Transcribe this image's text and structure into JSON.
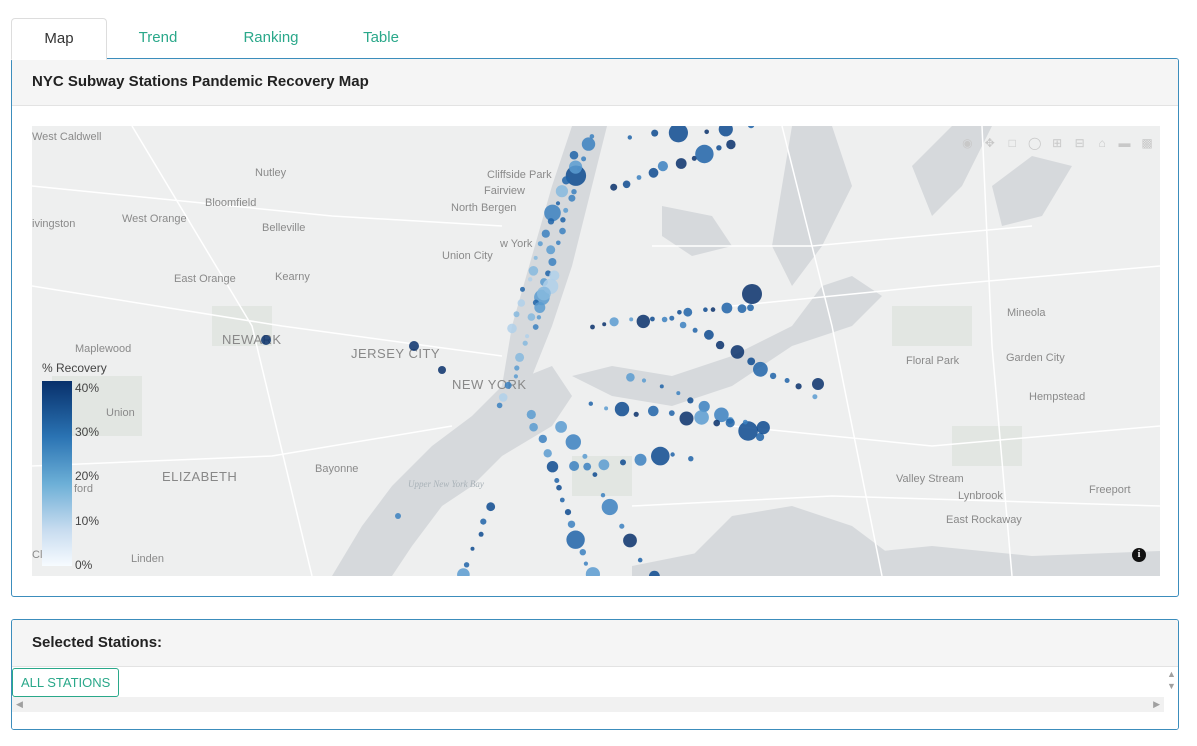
{
  "tabs": [
    {
      "label": "Map",
      "active": true
    },
    {
      "label": "Trend",
      "active": false
    },
    {
      "label": "Ranking",
      "active": false
    },
    {
      "label": "Table",
      "active": false
    }
  ],
  "map_panel": {
    "title": "NYC Subway Stations Pandemic Recovery Map",
    "legend": {
      "title": "% Recovery",
      "ticks": [
        "40%",
        "30%",
        "20%",
        "10%",
        "0%"
      ]
    },
    "places": [
      "West Caldwell",
      "Nutley",
      "Bloomfield",
      "West Orange",
      "Belleville",
      "ivingston",
      "East Orange",
      "Kearny",
      "NEWARK",
      "Maplewood",
      "JERSEY CITY",
      "Union",
      "ELIZABETH",
      "Bayonne",
      "Linden",
      "ford",
      "Cliffside Park",
      "Fairview",
      "North Bergen",
      "Union City",
      "w York",
      "NEW YORK",
      "Upper New York Bay",
      "Mineola",
      "Floral Park",
      "Garden City",
      "Hempstead",
      "Valley Stream",
      "Lynbrook",
      "Freeport",
      "East Rockaway",
      "Cl"
    ],
    "colors": {
      "high": "#08306b",
      "mid": "#2a73b3",
      "low": "#c6dbef",
      "accent": "#2aa88a",
      "border": "#3c8dbc"
    }
  },
  "selected_panel": {
    "title": "Selected Stations:",
    "button_label": "ALL STATIONS"
  },
  "icons": [
    "camera-icon",
    "zoom-icon",
    "pan-icon",
    "box-select-icon",
    "lasso-icon",
    "zoom-in-icon",
    "zoom-out-icon",
    "home-icon",
    "tag-icon",
    "plotly-logo-icon",
    "info-icon"
  ]
}
